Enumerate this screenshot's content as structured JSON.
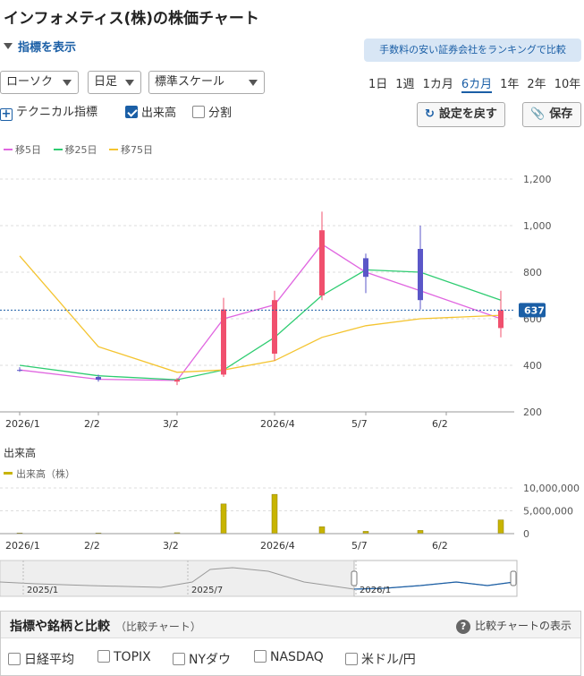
{
  "title": "インフォメティス(株)の株価チャート",
  "indicator_toggle": "指標を表示",
  "promo_link": "手数料の安い証券会社をランキングで比較",
  "selects": {
    "chart_type": "ローソク",
    "interval": "日足",
    "scale": "標準スケール"
  },
  "periods": [
    "1日",
    "1週",
    "1カ月",
    "6カ月",
    "1年",
    "2年",
    "10年"
  ],
  "active_period": "6カ月",
  "options": {
    "technical": "テクニカル指標",
    "volume": "出来高",
    "split": "分割"
  },
  "buttons": {
    "reset": "設定を戻す",
    "save": "保存"
  },
  "ma_legend": [
    "移5日",
    "移25日",
    "移75日"
  ],
  "current_price": "637",
  "volume_title": "出来高",
  "volume_legend": "出来高（株）",
  "navigator_labels": [
    "2025/1",
    "2025/7",
    "2026/1"
  ],
  "compare": {
    "title": "指標や銘柄と比較",
    "subtitle": "（比較チャート）",
    "show_link": "比較チャートの表示",
    "items": [
      "日経平均",
      "TOPIX",
      "NYダウ",
      "NASDAQ",
      "米ドル/円"
    ]
  },
  "colors": {
    "up": "#f0506e",
    "down": "#5b57c8",
    "ma5": "#e066e0",
    "ma25": "#2ecc71",
    "ma75": "#f4c430",
    "volume": "#c8b400",
    "accent": "#1b5fa6"
  },
  "chart_data": [
    {
      "type": "candlestick",
      "x_tick_labels": [
        "2026/1",
        "2/2",
        "3/2",
        "2026/4",
        "5/7",
        "6/2"
      ],
      "y_ticks": [
        200,
        400,
        600,
        800,
        "1,000",
        "1,200"
      ],
      "ylim": [
        200,
        1200
      ],
      "grid": true,
      "candles": [
        {
          "date": "2026/1",
          "open": 380,
          "high": 392,
          "low": 372,
          "close": 378
        },
        {
          "date": "2/2",
          "open": 350,
          "high": 360,
          "low": 330,
          "close": 338
        },
        {
          "date": "3/2",
          "open": 330,
          "high": 345,
          "low": 315,
          "close": 338
        },
        {
          "date": "3/16",
          "open": 360,
          "high": 690,
          "low": 350,
          "close": 640
        },
        {
          "date": "2026/4",
          "open": 450,
          "high": 720,
          "low": 420,
          "close": 680
        },
        {
          "date": "4/16",
          "open": 700,
          "high": 1060,
          "low": 680,
          "close": 980
        },
        {
          "date": "5/7",
          "open": 860,
          "high": 880,
          "low": 710,
          "close": 780
        },
        {
          "date": "6/2",
          "open": 900,
          "high": 1000,
          "low": 640,
          "close": 680
        },
        {
          "date": "6/16",
          "open": 560,
          "high": 720,
          "low": 520,
          "close": 637
        }
      ],
      "moving_averages": [
        {
          "name": "移5日",
          "values": [
            380,
            340,
            335,
            600,
            660,
            920,
            800,
            720,
            600
          ]
        },
        {
          "name": "移25日",
          "values": [
            400,
            355,
            338,
            380,
            520,
            700,
            810,
            800,
            680
          ]
        },
        {
          "name": "移75日",
          "values": [
            870,
            480,
            370,
            380,
            420,
            520,
            570,
            600,
            615
          ]
        }
      ]
    },
    {
      "type": "bar",
      "x_tick_labels": [
        "2026/1",
        "2/2",
        "3/2",
        "2026/4",
        "5/7",
        "6/2"
      ],
      "y_ticks": [
        "0",
        "5,000,000",
        "10,000,000"
      ],
      "ylim": [
        0,
        10000000
      ],
      "values": [
        150000,
        150000,
        200000,
        6500000,
        8600000,
        1500000,
        500000,
        700000,
        3000000
      ]
    }
  ]
}
